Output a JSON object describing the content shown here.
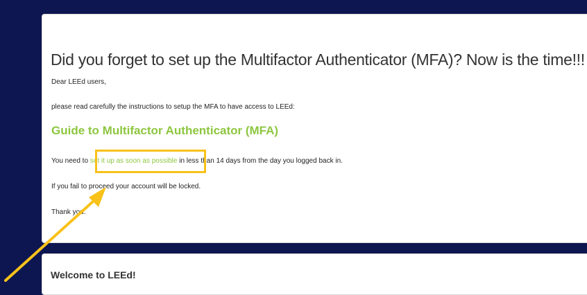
{
  "mfa_notice": {
    "title": "Did you forget to set up the Multifactor Authenticator (MFA)? Now is the time!!!",
    "greeting": "Dear LEEd users,",
    "intro": "please read carefully the instructions to setup the MFA to have access to LEEd:",
    "guide_link": "Guide to Multifactor Authenticator (MFA)",
    "setup_prefix": "You need to ",
    "setup_link": "set it up as soon as possible",
    "setup_suffix": " in less than 14 days from the day you logged back in.",
    "locked_warning": "If you fail to proceed your account will be locked.",
    "thanks": "Thank you."
  },
  "welcome": {
    "title": "Welcome to LEEd!"
  },
  "colors": {
    "background": "#0d1650",
    "accent_green": "#8dc63f",
    "highlight": "#f9c21a"
  }
}
